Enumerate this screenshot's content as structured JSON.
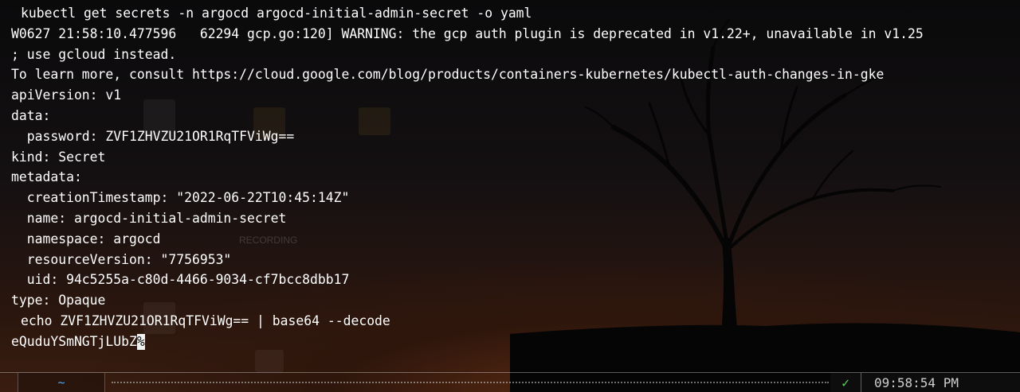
{
  "terminal": {
    "lines": [
      {
        "prompt": true,
        "text": "kubectl get secrets -n argocd argocd-initial-admin-secret -o yaml"
      },
      {
        "prompt": false,
        "text": "W0627 21:58:10.477596   62294 gcp.go:120] WARNING: the gcp auth plugin is deprecated in v1.22+, unavailable in v1.25"
      },
      {
        "prompt": false,
        "text": "; use gcloud instead."
      },
      {
        "prompt": false,
        "text": "To learn more, consult https://cloud.google.com/blog/products/containers-kubernetes/kubectl-auth-changes-in-gke"
      },
      {
        "prompt": false,
        "text": "apiVersion: v1"
      },
      {
        "prompt": false,
        "text": "data:"
      },
      {
        "prompt": false,
        "text": "  password: ZVF1ZHVZU21OR1RqTFViWg=="
      },
      {
        "prompt": false,
        "text": "kind: Secret"
      },
      {
        "prompt": false,
        "text": "metadata:"
      },
      {
        "prompt": false,
        "text": "  creationTimestamp: \"2022-06-22T10:45:14Z\""
      },
      {
        "prompt": false,
        "text": "  name: argocd-initial-admin-secret"
      },
      {
        "prompt": false,
        "text": "  namespace: argocd"
      },
      {
        "prompt": false,
        "text": "  resourceVersion: \"7756953\""
      },
      {
        "prompt": false,
        "text": "  uid: 94c5255a-c80d-4466-9034-cf7bcc8dbb17"
      },
      {
        "prompt": false,
        "text": "type: Opaque"
      },
      {
        "prompt": true,
        "text": "echo ZVF1ZHVZU21OR1RqTFViWg== | base64 --decode"
      }
    ],
    "output_line": {
      "text": "eQuduYSmNGTjLUbZ",
      "cursor_char": "%"
    },
    "prompt_symbol": "❯"
  },
  "statusbar": {
    "directory": "~",
    "status_icon": "✓",
    "time": "09:58:54 PM"
  },
  "colors": {
    "prompt": "#5fd35f",
    "directory": "#49a8ff",
    "text": "#ffffff"
  }
}
